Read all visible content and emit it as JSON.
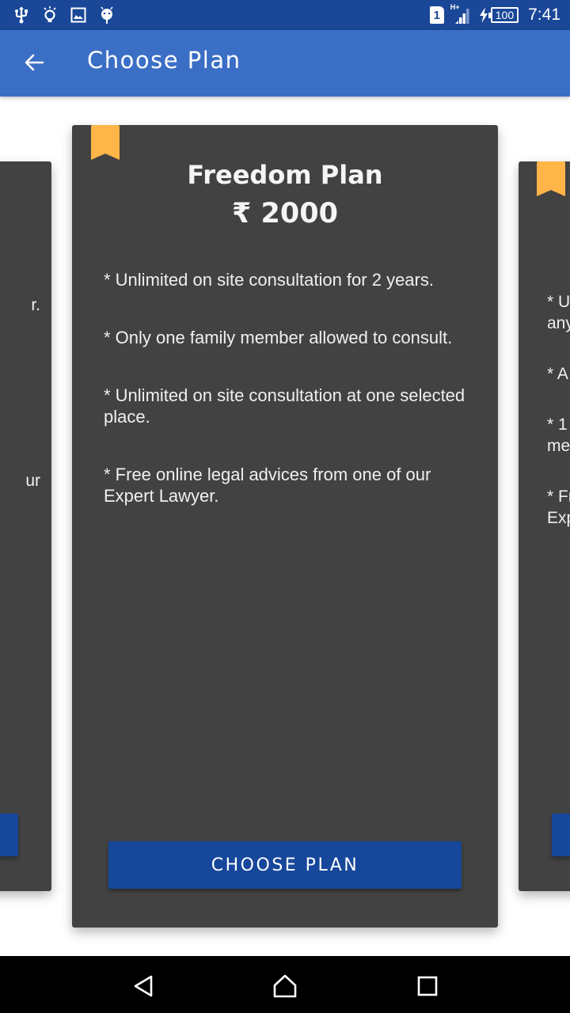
{
  "status_bar": {
    "left_icons": [
      "usb-icon",
      "lightbulb-icon",
      "image-icon",
      "android-icon"
    ],
    "sim_slot": "1",
    "network_type": "H+",
    "battery_level": "100",
    "charging": true,
    "time": "7:41"
  },
  "app_bar": {
    "back_icon": "arrow-left-icon",
    "title": "Choose Plan"
  },
  "colors": {
    "status_bar": "#1a4797",
    "app_bar": "#3b6fc6",
    "card_bg": "#424242",
    "bookmark": "#ffb547",
    "button": "#17479a"
  },
  "plans": {
    "left_partial": {
      "visible_fragments": [
        "r.",
        "ur"
      ]
    },
    "center": {
      "title": "Freedom Plan",
      "price": "₹ 2000",
      "features": [
        "* Unlimited on site consultation for 2 years.",
        "* Only one family member allowed to consult.",
        "* Unlimited on site consultation at one selected place.",
        "* Free online legal advices from one of our Expert Lawyer."
      ],
      "button_label": "CHOOSE PLAN"
    },
    "right_partial": {
      "visible_fragments": [
        "* U",
        "any",
        "* A",
        "* 1",
        "me",
        "* Fr",
        "Exp"
      ]
    }
  },
  "nav_bar": {
    "buttons": [
      "back-icon",
      "home-icon",
      "recents-icon"
    ]
  }
}
